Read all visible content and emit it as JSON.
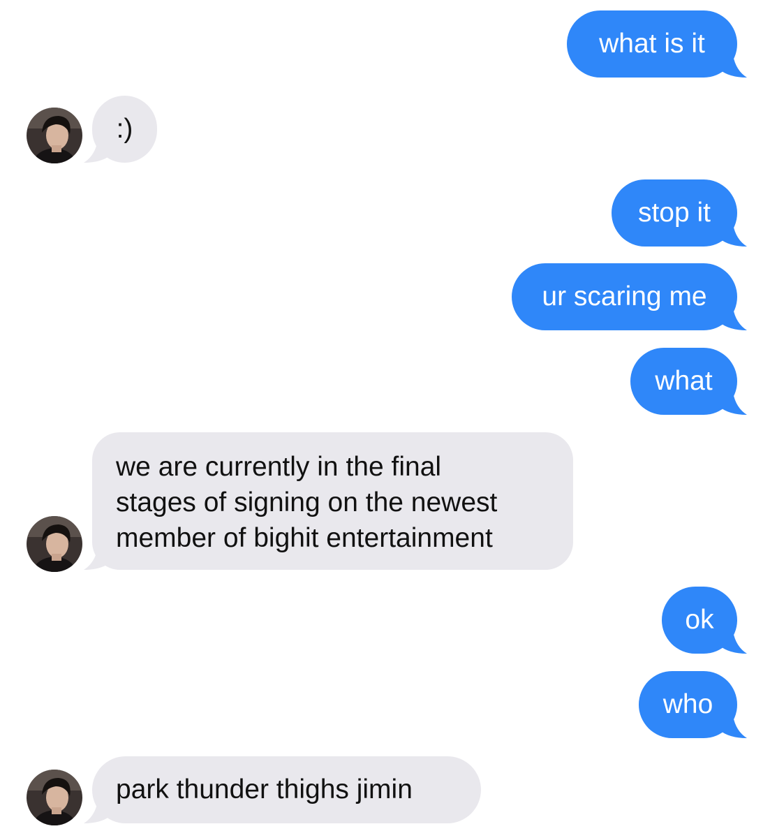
{
  "conversation": {
    "theme": {
      "outgoing_bubble_color": "#2f87f9",
      "incoming_bubble_color": "#e9e8ed",
      "outgoing_text_color": "#ffffff",
      "incoming_text_color": "#111111",
      "background_color": "#ffffff"
    },
    "messages": [
      {
        "direction": "outgoing",
        "text": "what is it"
      },
      {
        "direction": "incoming",
        "text": ":)",
        "avatar_icon": "contact-avatar-icon"
      },
      {
        "direction": "outgoing",
        "text": "stop it"
      },
      {
        "direction": "outgoing",
        "text": "ur scaring me"
      },
      {
        "direction": "outgoing",
        "text": "what"
      },
      {
        "direction": "incoming",
        "text": "we are currently in the final\nstages of signing on the newest\nmember of bighit entertainment",
        "avatar_icon": "contact-avatar-icon"
      },
      {
        "direction": "outgoing",
        "text": "ok"
      },
      {
        "direction": "outgoing",
        "text": "who"
      },
      {
        "direction": "incoming",
        "text": "park thunder thighs jimin",
        "avatar_icon": "contact-avatar-icon"
      }
    ]
  }
}
